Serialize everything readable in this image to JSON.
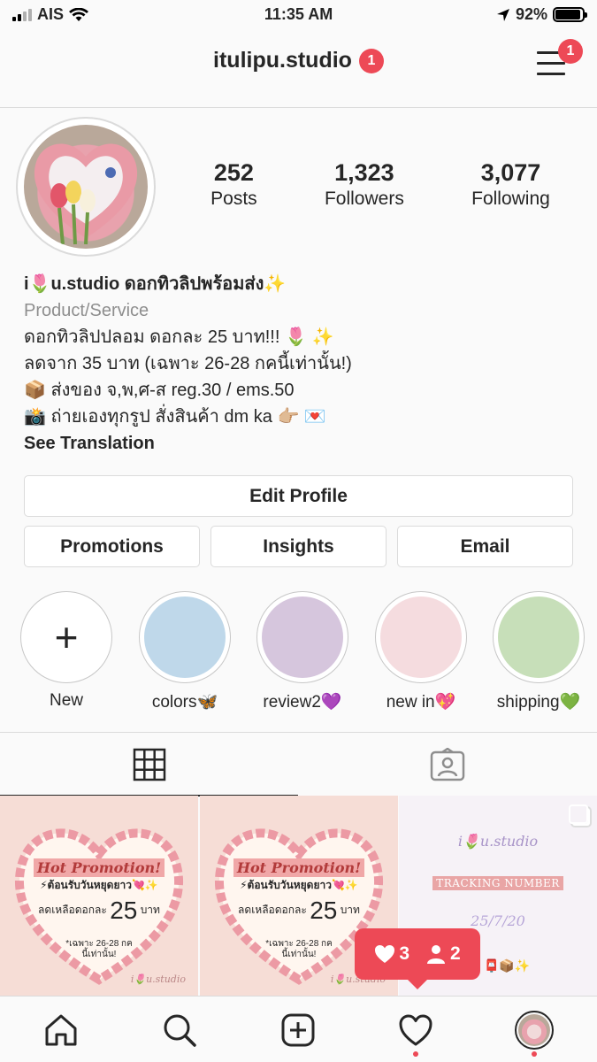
{
  "status_bar": {
    "carrier": "AIS",
    "time": "11:35 AM",
    "battery": "92%",
    "battery_level": 0.92
  },
  "header": {
    "username": "itulipu.studio",
    "account_badge": "1",
    "menu_badge": "1"
  },
  "profile": {
    "stats": [
      {
        "value": "252",
        "label": "Posts"
      },
      {
        "value": "1,323",
        "label": "Followers"
      },
      {
        "value": "3,077",
        "label": "Following"
      }
    ],
    "bio": {
      "name": "i🌷u.studio ดอกทิวลิปพร้อมส่ง✨",
      "category": "Product/Service",
      "lines": [
        "ดอกทิวลิปปลอม ดอกละ 25 บาท!!! 🌷 ✨",
        "ลดจาก 35 บาท (เฉพาะ 26-28 กคนี้เท่านั้น!)",
        "📦 ส่งของ จ,พ,ศ-ส reg.30 / ems.50",
        "📸 ถ่ายเองทุกรูป สั่งสินค้า dm ka 👉🏼 💌"
      ],
      "see_translation": "See Translation"
    }
  },
  "buttons": {
    "edit_profile": "Edit Profile",
    "promotions": "Promotions",
    "insights": "Insights",
    "email": "Email"
  },
  "highlights": [
    {
      "label": "New",
      "color": "",
      "icon": "plus-icon"
    },
    {
      "label": "colors🦋",
      "color": "#bfd8ea"
    },
    {
      "label": "review2💜",
      "color": "#d6c6dd"
    },
    {
      "label": "new in💖",
      "color": "#f5dcdf"
    },
    {
      "label": "shipping💚",
      "color": "#c7dfb9"
    }
  ],
  "tabs": [
    {
      "name": "grid",
      "icon": "grid-icon",
      "active": true
    },
    {
      "name": "tagged",
      "icon": "tagged-person-icon",
      "active": false
    }
  ],
  "posts": [
    {
      "type": "promotion",
      "title": "Hot Promotion!",
      "welcome": "⚡ต้อนรับวันหยุดยาว💘✨",
      "price_prefix": "ลดเหลือดอกละ",
      "price_value": "25",
      "price_unit": "บาท",
      "note_line1": "*เฉพาะ 26-28 กค",
      "note_line2": "นี้เท่านั้น!",
      "watermark": "i🌷u.studio"
    },
    {
      "type": "promotion",
      "title": "Hot Promotion!",
      "welcome": "⚡ต้อนรับวันหยุดยาว💘✨",
      "price_prefix": "ลดเหลือดอกละ",
      "price_value": "25",
      "price_unit": "บาท",
      "note_line1": "*เฉพาะ 26-28 กค",
      "note_line2": "นี้เท่านั้น!",
      "watermark": "i🌷u.studio"
    },
    {
      "type": "tracking",
      "brand": "i🌷u.studio",
      "title": "TRACKING NUMBER",
      "date": "25/7/20",
      "footer_icons": "📮📦✨"
    }
  ],
  "activity": {
    "likes": "3",
    "follows": "2",
    "color": "#ed4956"
  },
  "tab_bar": [
    {
      "name": "home",
      "icon": "home-icon"
    },
    {
      "name": "search",
      "icon": "search-icon"
    },
    {
      "name": "new-post",
      "icon": "add-post-icon"
    },
    {
      "name": "activity",
      "icon": "heart-icon"
    },
    {
      "name": "profile",
      "icon": "profile-avatar-icon"
    }
  ]
}
